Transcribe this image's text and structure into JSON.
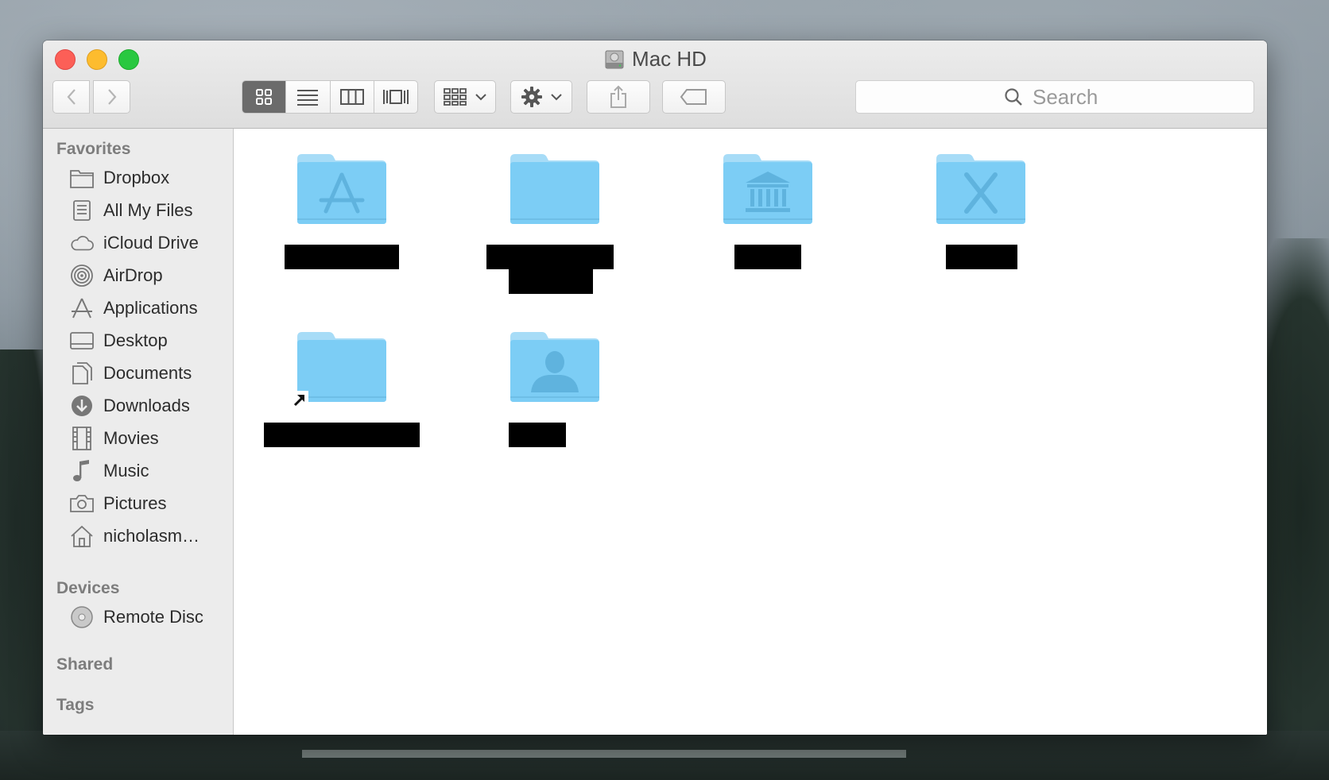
{
  "window": {
    "title": "Mac HD"
  },
  "toolbar": {
    "back_icon": "chevron-left-icon",
    "forward_icon": "chevron-right-icon",
    "views": [
      "icon-view",
      "list-view",
      "column-view",
      "cover-flow-view"
    ],
    "active_view": "icon-view",
    "arrange_icon": "arrange-grid-icon",
    "action_icon": "gear-icon",
    "share_icon": "share-icon",
    "tag_icon": "tag-icon",
    "search_placeholder": "Search"
  },
  "sidebar": {
    "favorites_heading": "Favorites",
    "favorites": [
      {
        "label": "Dropbox",
        "icon": "folder-icon"
      },
      {
        "label": "All My Files",
        "icon": "all-files-icon"
      },
      {
        "label": "iCloud Drive",
        "icon": "cloud-icon"
      },
      {
        "label": "AirDrop",
        "icon": "airdrop-icon"
      },
      {
        "label": "Applications",
        "icon": "applications-icon"
      },
      {
        "label": "Desktop",
        "icon": "desktop-icon"
      },
      {
        "label": "Documents",
        "icon": "documents-icon"
      },
      {
        "label": "Downloads",
        "icon": "download-icon"
      },
      {
        "label": "Movies",
        "icon": "film-icon"
      },
      {
        "label": "Music",
        "icon": "music-note-icon"
      },
      {
        "label": "Pictures",
        "icon": "camera-icon"
      },
      {
        "label": "nicholasm…",
        "icon": "home-icon"
      }
    ],
    "devices_heading": "Devices",
    "devices": [
      {
        "label": "Remote Disc",
        "icon": "disc-icon"
      }
    ],
    "shared_heading": "Shared",
    "tags_heading": "Tags"
  },
  "content": {
    "items": [
      {
        "folder_type": "applications",
        "emblem": "app-store-a",
        "label_redacted": true
      },
      {
        "folder_type": "plain",
        "emblem": "",
        "label_redacted": true
      },
      {
        "folder_type": "library",
        "emblem": "library-columns",
        "label_redacted": true
      },
      {
        "folder_type": "system",
        "emblem": "X",
        "label_redacted": true
      },
      {
        "folder_type": "alias",
        "emblem": "",
        "label_redacted": true
      },
      {
        "folder_type": "users",
        "emblem": "user-silhouette",
        "label_redacted": true
      }
    ]
  },
  "colors": {
    "folder_body": "#7ccdf5",
    "folder_tab": "#a7dcf7",
    "folder_emblem": "#5fb3de",
    "selected_segment": "#6b6b6b"
  }
}
